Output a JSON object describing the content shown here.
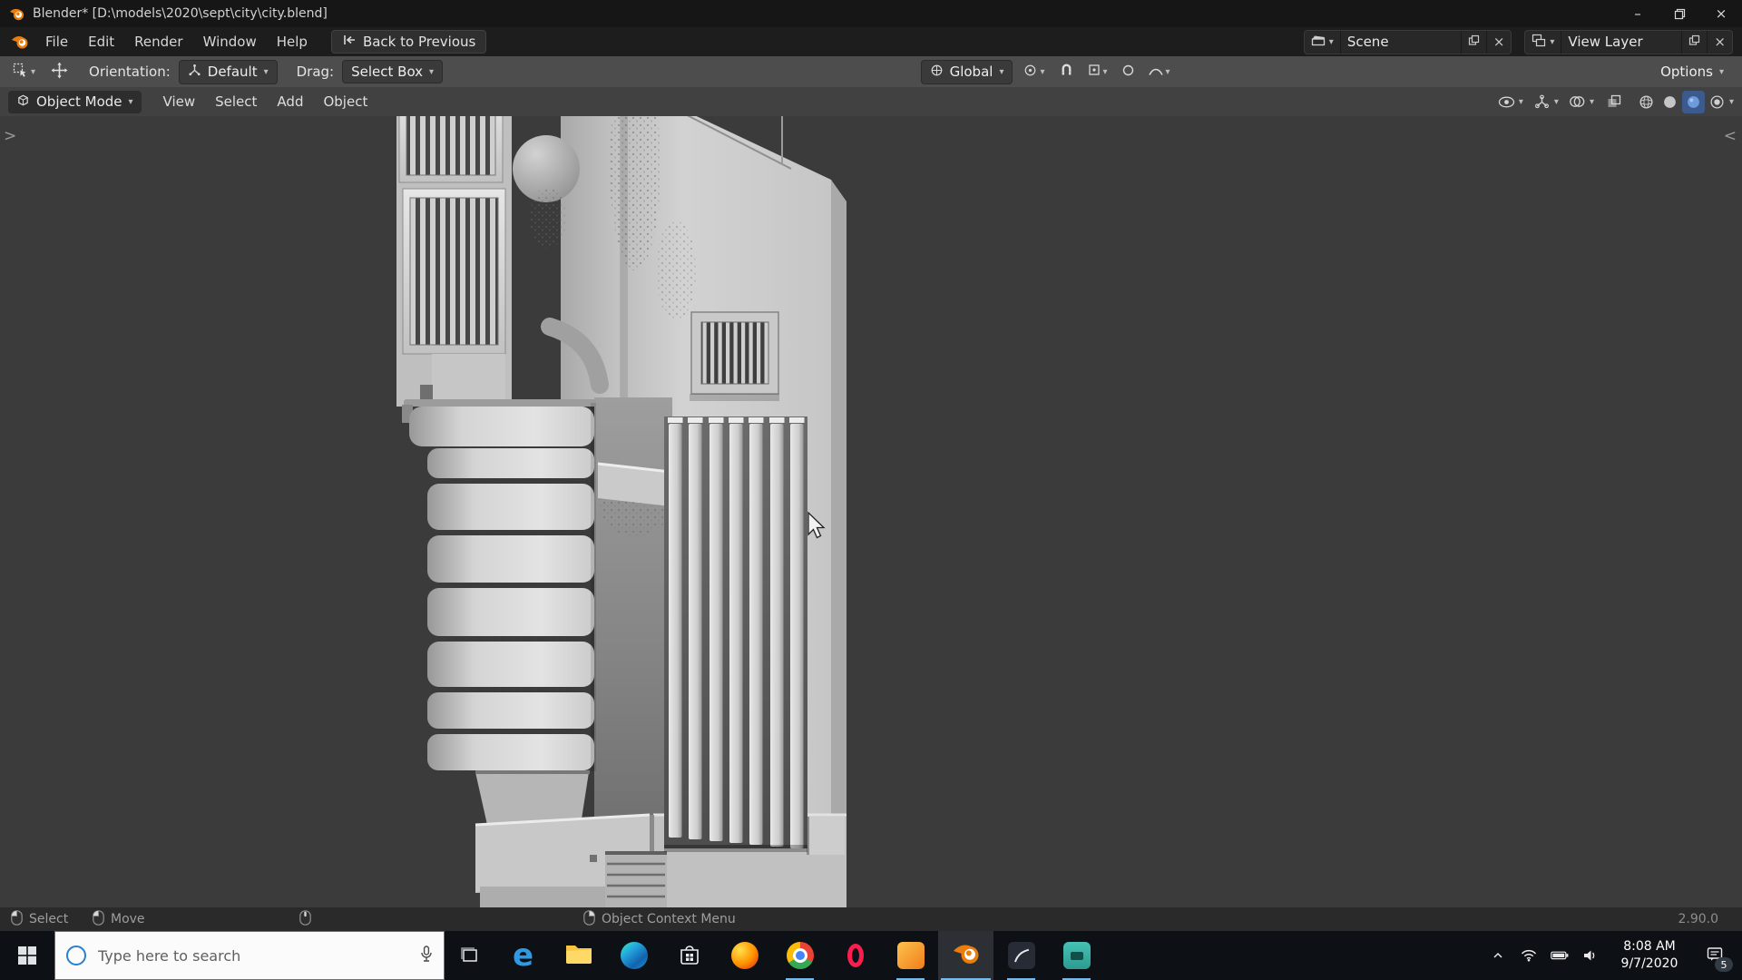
{
  "colors": {
    "blender_orange": "#e87d0d",
    "accent_blue": "#4772b3",
    "taskbar_underline": "#76b9ed",
    "viewport_background": "#3b3b3b"
  },
  "title_bar": {
    "title": "Blender* [D:\\models\\2020\\sept\\city\\city.blend]"
  },
  "top_bar": {
    "menus": [
      "File",
      "Edit",
      "Render",
      "Window",
      "Help"
    ],
    "back_button": "Back to Previous",
    "scene_name": "Scene",
    "view_layer_name": "View Layer"
  },
  "tool_bar": {
    "orientation_label": "Orientation:",
    "orientation_value": "Default",
    "drag_label": "Drag:",
    "drag_value": "Select Box",
    "transform_space": "Global",
    "options_label": "Options"
  },
  "viewport": {
    "mode": "Object Mode",
    "menus": [
      "View",
      "Select",
      "Add",
      "Object"
    ]
  },
  "status_bar": {
    "select_label": "Select",
    "move_label": "Move",
    "context_label": "Object Context Menu",
    "version": "2.90.0"
  },
  "taskbar": {
    "search_placeholder": "Type here to search",
    "time": "8:08 AM",
    "date": "9/7/2020",
    "notification_count": "5"
  }
}
